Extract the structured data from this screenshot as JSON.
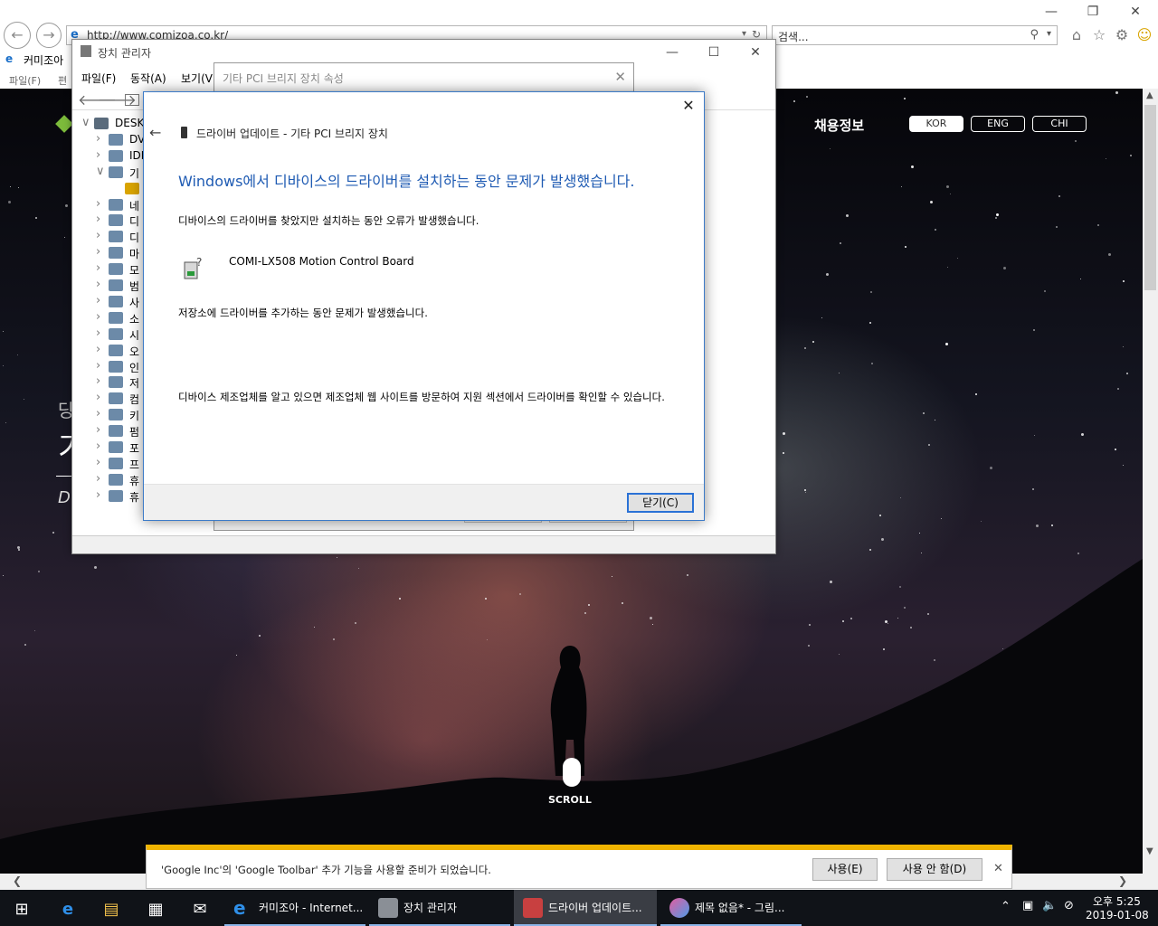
{
  "browser": {
    "url": "http://www.comizoa.co.kr/",
    "search_placeholder": "검색...",
    "tab_title": "커미조아",
    "menu": [
      "파일(F)",
      "편"
    ]
  },
  "website": {
    "recruit": "채용정보",
    "langs": [
      "KOR",
      "ENG",
      "CHI"
    ],
    "scroll": "SCROLL",
    "side_letters": [
      "당",
      "기",
      "D"
    ]
  },
  "device_manager": {
    "title": "장치 관리자",
    "menu": [
      "파일(F)",
      "동작(A)",
      "보기(V)"
    ],
    "tree": [
      "DESKT",
      "DV",
      "IDE",
      "기타",
      "",
      "네",
      "디",
      "디",
      "마",
      "모",
      "범",
      "사",
      "소",
      "시",
      "오",
      "인",
      "저",
      "컴",
      "키",
      "펌",
      "포",
      "프",
      "휴",
      "휴"
    ]
  },
  "props_window": {
    "title": "기타 PCI 브리지 장치 속성"
  },
  "dialog": {
    "title": "드라이버 업데이트 - 기타 PCI 브리지 장치",
    "heading": "Windows에서 디바이스의 드라이버를 설치하는 동안 문제가 발생했습니다.",
    "p1": "디바이스의 드라이버를 찾았지만 설치하는 동안 오류가 발생했습니다.",
    "device_name": "COMI-LX508 Motion Control Board",
    "p2": "저장소에 드라이버를 추가하는 동안 문제가 발생했습니다.",
    "p3": "디바이스 제조업체를 알고 있으면 제조업체 웹 사이트를 방문하여 지원 섹션에서 드라이버를 확인할 수 있습니다.",
    "close_button": "닫기(C)"
  },
  "notification": {
    "text": "'Google Inc'의 'Google Toolbar' 추가 기능을 사용할 준비가 되었습니다.",
    "enable": "사용(E)",
    "disable": "사용 안 함(D)"
  },
  "taskbar": {
    "tasks": [
      "커미조아 - Internet...",
      "장치 관리자",
      "드라이버 업데이트...",
      "제목 없음* - 그림..."
    ],
    "time": "오후 5:25",
    "date": "2019-01-08"
  },
  "colors": {
    "accent": "#1f5bb3",
    "notify_bar": "#f0b400",
    "taskbar": "#101318"
  }
}
